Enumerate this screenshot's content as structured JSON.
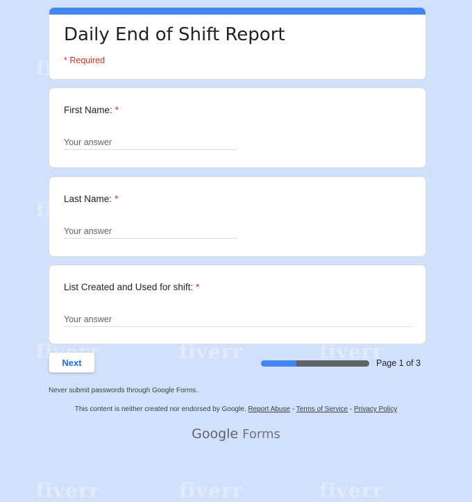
{
  "form": {
    "title": "Daily End of Shift Report",
    "required_note": "* Required"
  },
  "questions": [
    {
      "label": "First Name:",
      "star": "*",
      "placeholder": "Your answer"
    },
    {
      "label": "Last Name:",
      "star": "*",
      "placeholder": "Your answer"
    },
    {
      "label": "List Created and Used for shift:",
      "star": "*",
      "placeholder": "Your answer"
    }
  ],
  "navigation": {
    "next_label": "Next",
    "progress_fraction": 0.33,
    "page_label": "Page 1 of 3"
  },
  "footer": {
    "warning": "Never submit passwords through Google Forms.",
    "disclaimer": "This content is neither created nor endorsed by Google.",
    "report_abuse": "Report Abuse",
    "separator": " - ",
    "terms": "Terms of Service",
    "privacy": "Privacy Policy",
    "brand_google": "Google",
    "brand_forms": "Forms"
  },
  "watermark_text": "fiverr",
  "colors": {
    "background": "#d1e1fb",
    "accent": "#4285f4",
    "required": "#d93025",
    "button_text": "#1a73e8"
  }
}
